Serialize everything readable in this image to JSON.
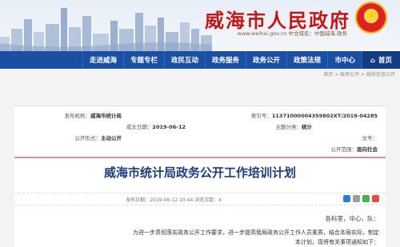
{
  "header": {
    "site_title": "威海市人民政府",
    "site_sub": "www.weihai.gov.cn 中文域名：中国威海.政务"
  },
  "nav": {
    "items": [
      {
        "label": "首页",
        "icon": "home-icon",
        "home": true
      },
      {
        "label": "市中心"
      },
      {
        "label": "政策法规"
      },
      {
        "label": "政务公开"
      },
      {
        "label": "政务服务"
      },
      {
        "label": "政民互动"
      },
      {
        "label": "专题专栏"
      },
      {
        "label": "走进威海"
      }
    ]
  },
  "breadcrumb": "首页 > 政务公开 > 政府信息公开",
  "info": {
    "index_label": "索引号：",
    "index_value": "11371000004359802XT/2019-04285",
    "org_label": "发布机构：",
    "org_value": "威海市统计局",
    "category_label": "主题分类：",
    "category_value": "统计",
    "date_label": "成文日期：",
    "date_value": "2019-06-12",
    "docno_label": "文号：",
    "docno_value": "",
    "form_label": "公开形式：",
    "form_value": "主动公开",
    "scope_label": "公开范围：",
    "scope_value": "面向社会"
  },
  "article": {
    "title": "威海市统计局政务公开工作培训计划",
    "meta": "发布日期：2019-06-12 10:44  浏览次数：4",
    "greeting": "各科室，中心，队：",
    "paras": [
      "为进一步贯彻落实政务公开工作要求，进一步提高我局政务公开工作人员素质，结合本局实际，制定",
      "本计划，现将有关事项通知如下："
    ]
  },
  "colors": {
    "nav_bg": "#1a4fa3",
    "title_red": "#c21717",
    "article_title": "#1f3d7a"
  }
}
